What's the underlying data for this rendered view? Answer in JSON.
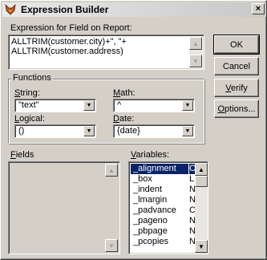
{
  "window": {
    "title": "Expression Builder",
    "close_glyph": "×"
  },
  "expression": {
    "label": "Expression for Field on Report:",
    "lines": [
      "ALLTRIM(customer.city)+\", \"+",
      "ALLTRIM(customer.address)"
    ]
  },
  "buttons": {
    "ok": "OK",
    "cancel": "Cancel",
    "verify": "Verify",
    "options": "Options..."
  },
  "functions": {
    "group_label": "Functions",
    "string_label": "String:",
    "string_value": "\"text\"",
    "math_label": "Math:",
    "math_value": "^",
    "logical_label": "Logical:",
    "logical_value": "()",
    "date_label": "Date:",
    "date_value": "{date}"
  },
  "fields": {
    "label": "Fields"
  },
  "variables": {
    "label": "Variables:",
    "items": [
      {
        "name": "_alignment",
        "type": "C"
      },
      {
        "name": "_box",
        "type": "L"
      },
      {
        "name": "_indent",
        "type": "N"
      },
      {
        "name": "_lmargin",
        "type": "N"
      },
      {
        "name": "_padvance",
        "type": "C"
      },
      {
        "name": "_pageno",
        "type": "N"
      },
      {
        "name": "_pbpage",
        "type": "N"
      },
      {
        "name": "_pcopies",
        "type": "N"
      }
    ]
  },
  "icons": {
    "app": "fox-logo-icon",
    "scroll_up": "▲",
    "scroll_down": "▼",
    "combo_arrow": "▼"
  }
}
